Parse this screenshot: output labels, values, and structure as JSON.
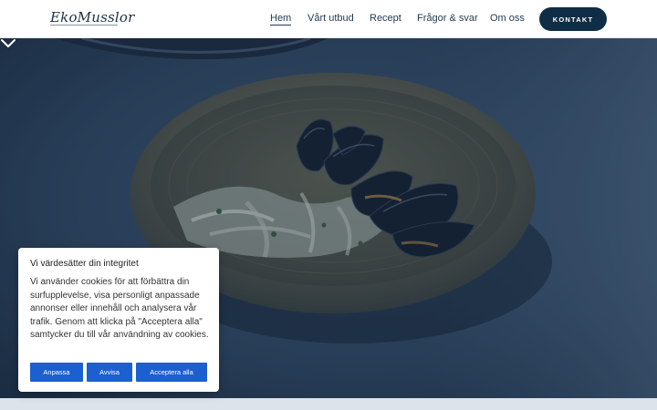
{
  "header": {
    "logo_text": "EkoMusslor",
    "nav": [
      {
        "label": "Hem",
        "active": true
      },
      {
        "label": "Vårt utbud",
        "active": false
      },
      {
        "label": "Recept",
        "active": false
      },
      {
        "label": "Frågor & svar",
        "active": false
      },
      {
        "label": "Om oss",
        "active": false
      }
    ],
    "contact_label": "KONTAKT"
  },
  "hero": {
    "image": "mussels-in-ceramic-bowl",
    "scroll_icon": "chevron-down-icon"
  },
  "cookie_banner": {
    "title": "Vi värdesätter din integritet",
    "text": "Vi använder cookies för att förbättra din surfupplevelse, visa personligt anpassade annonser eller innehåll och analysera vår trafik. Genom att klicka på \"Acceptera alla\" samtycker du till vår användning av cookies.",
    "buttons": {
      "customize": "Anpassa",
      "reject": "Avvisa",
      "accept_all": "Acceptera alla"
    }
  },
  "colors": {
    "brand_dark": "#0f2e46",
    "button_blue": "#1b5fd1",
    "nav_text": "#1f3a52"
  }
}
